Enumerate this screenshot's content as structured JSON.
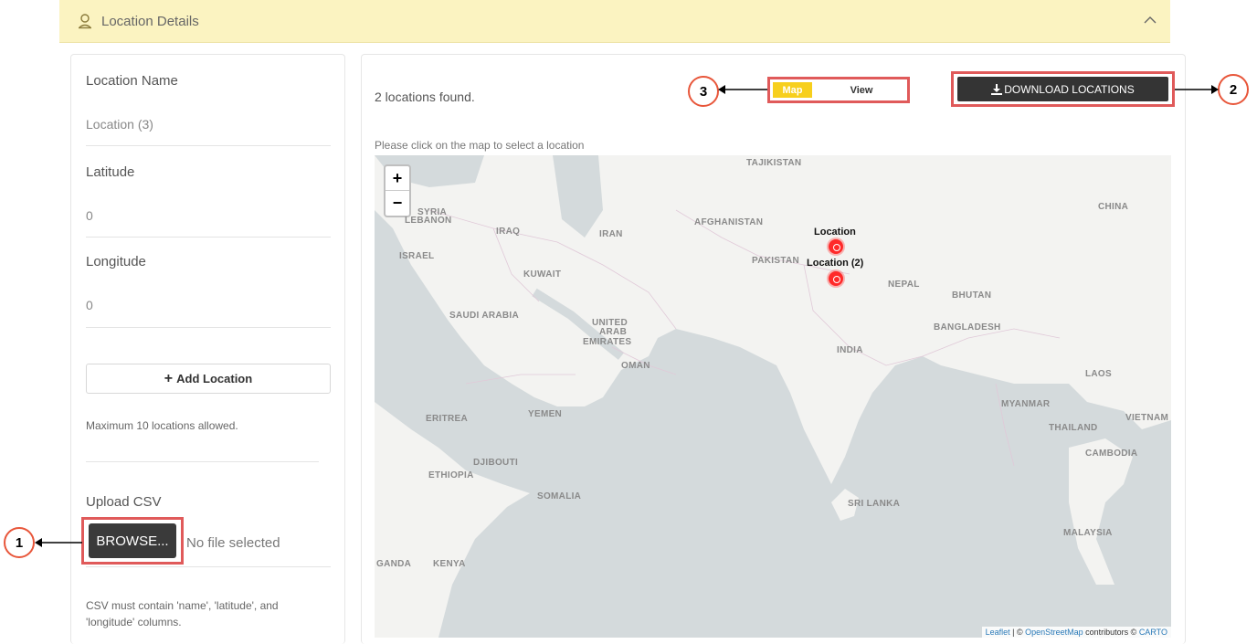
{
  "header": {
    "title": "Location Details",
    "pin_icon": "location-pin-icon",
    "collapse_icon": "chevron-up-icon"
  },
  "form": {
    "name_label": "Location Name",
    "name_value": "Location (3)",
    "lat_label": "Latitude",
    "lat_value": "0",
    "lon_label": "Longitude",
    "lon_value": "0",
    "add_button": "Add Location",
    "max_note": "Maximum 10 locations allowed.",
    "upload_label": "Upload CSV",
    "browse_button": "BROWSE...",
    "no_file": "No file selected",
    "csv_note": "CSV must contain 'name', 'latitude', and 'longitude' columns."
  },
  "results": {
    "found_text": "2 locations found.",
    "instruction": "Please click on the map to select a location",
    "toggle_map": "Map",
    "toggle_view": "View",
    "download_button": "DOWNLOAD LOCATIONS"
  },
  "map": {
    "zoom_in": "+",
    "zoom_out": "−",
    "labels": {
      "tajikistan": "TAJIKISTAN",
      "china": "CHINA",
      "syria": "SYRIA",
      "lebanon": "LEBANON",
      "iraq": "IRAQ",
      "iran": "IRAN",
      "afghanistan": "AFGHANISTAN",
      "israel": "ISRAEL",
      "kuwait": "KUWAIT",
      "pakistan": "PAKISTAN",
      "nepal": "NEPAL",
      "bhutan": "BHUTAN",
      "saudi": "SAUDI ARABIA",
      "uae1": "UNITED",
      "uae2": "ARAB",
      "uae3": "EMIRATES",
      "bangladesh": "BANGLADESH",
      "india": "INDIA",
      "oman": "OMAN",
      "laos": "LAOS",
      "myanmar": "MYANMAR",
      "yemen": "YEMEN",
      "eritrea": "ERITREA",
      "thailand": "THAILAND",
      "vietnam": "VIETNAM",
      "cambodia": "CAMBODIA",
      "djibouti": "DJIBOUTI",
      "ethiopia": "ETHIOPIA",
      "somalia": "SOMALIA",
      "srilanka": "SRI LANKA",
      "malaysia": "MALAYSIA",
      "uganda": "GANDA",
      "kenya": "KENYA"
    },
    "markers": [
      {
        "label": "Location"
      },
      {
        "label": "Location (2)"
      }
    ],
    "attribution": {
      "leaflet": "Leaflet",
      "sep1": " | © ",
      "osm": "OpenStreetMap",
      "mid": " contributors © ",
      "carto": "CARTO"
    }
  },
  "callouts": {
    "c1": "1",
    "c2": "2",
    "c3": "3"
  },
  "colors": {
    "header_bg": "#fbf3c1",
    "highlight": "#e05a5a",
    "toggle_active": "#f7cf1d",
    "marker": "#ff2a2a"
  }
}
